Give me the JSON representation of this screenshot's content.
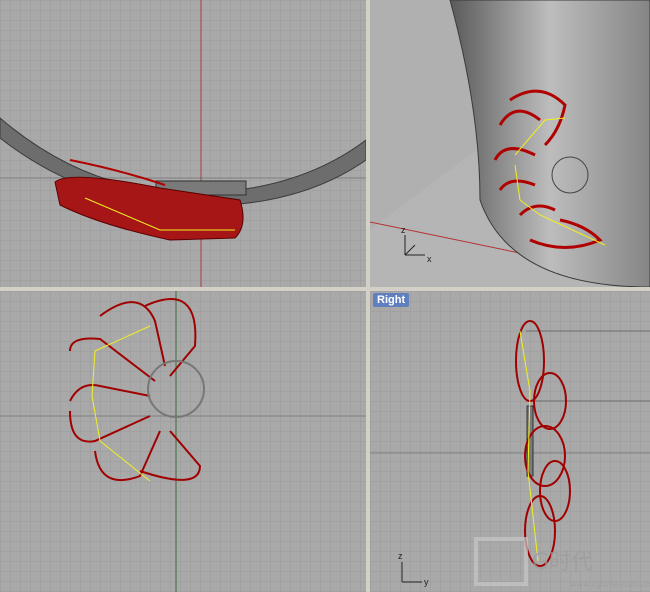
{
  "viewports": {
    "top": {
      "label": ""
    },
    "perspective": {
      "label": "",
      "axis_x": "x",
      "axis_z": "z"
    },
    "front": {
      "label": ""
    },
    "right": {
      "label": "Right",
      "axis_y": "y",
      "axis_z": "z"
    }
  },
  "watermark": {
    "text": "G时代",
    "subtext": "www.cgtime.com.cn"
  },
  "colors": {
    "grid_bg": "#a9a9a9",
    "grid_line": "#a0a0a0",
    "wire_red": "#b00000",
    "highlight_yellow": "#f0f020",
    "label_bg": "#5f7fbf"
  }
}
